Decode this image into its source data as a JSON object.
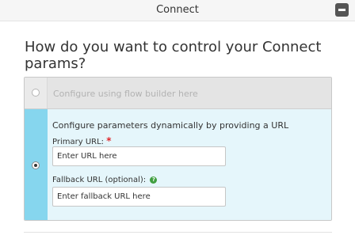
{
  "window": {
    "title": "Connect",
    "close_icon": "minus-close-icon"
  },
  "question": "How do you want to control your Connect params?",
  "options": [
    {
      "label": "Configure using flow builder here",
      "selected": false
    },
    {
      "label": "Configure parameters dynamically by providing a URL",
      "selected": true
    }
  ],
  "fields": {
    "primary_url": {
      "label": "Primary URL:",
      "required_mark": "*",
      "placeholder": "Enter URL here"
    },
    "fallback_url": {
      "label": "Fallback URL (optional):",
      "help_icon": "?",
      "placeholder": "Enter fallback URL here"
    }
  },
  "colors": {
    "selected_rail": "#86d6ee",
    "selected_bg": "#e5f6fb",
    "required": "#e0282c",
    "help": "#3f9e3f"
  }
}
